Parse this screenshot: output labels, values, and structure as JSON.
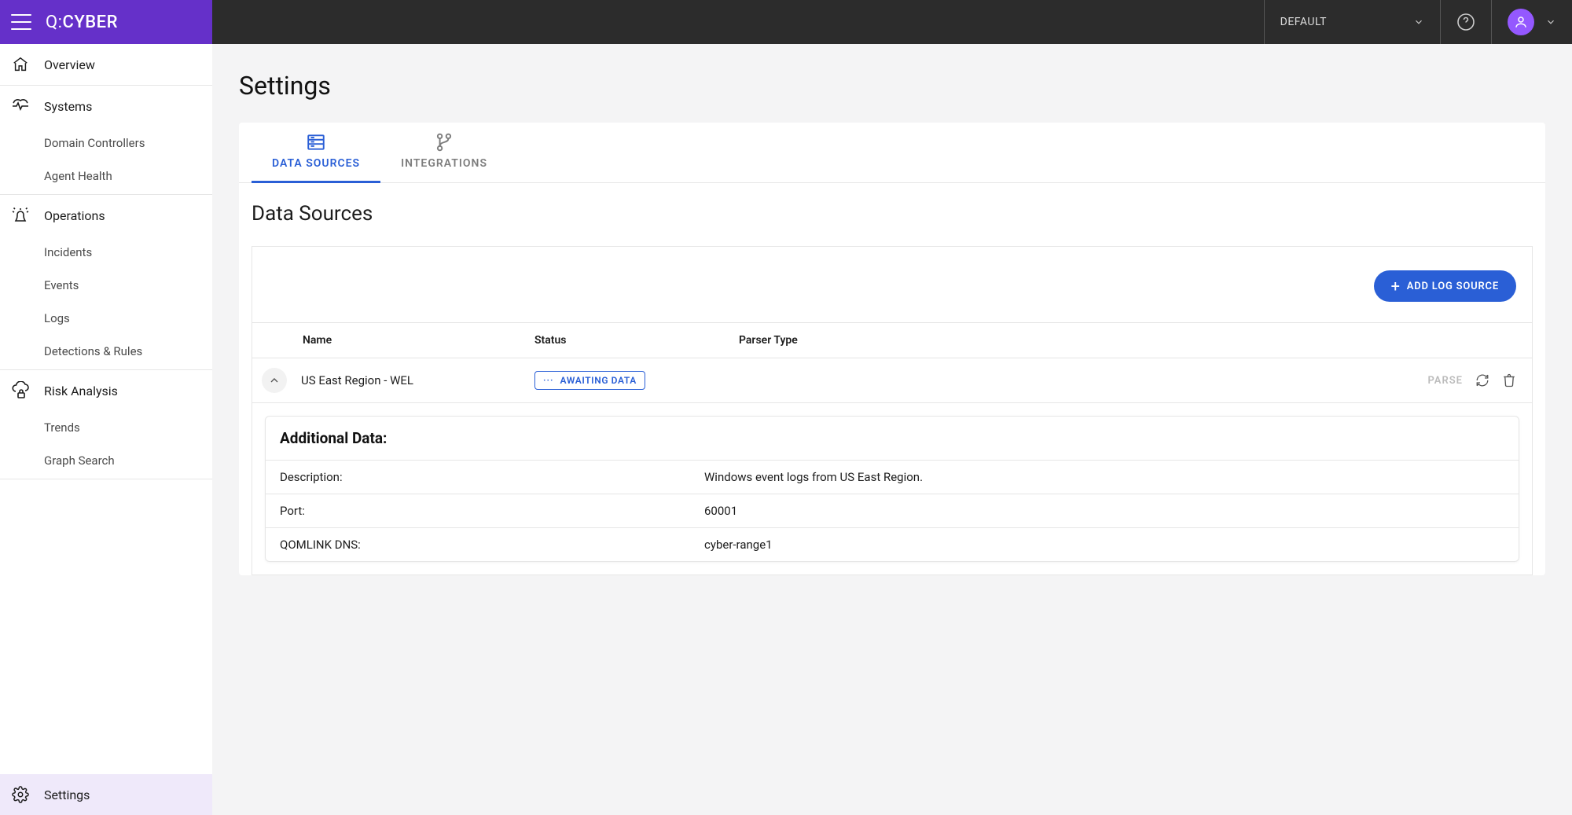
{
  "brand": {
    "prefix": "Q:",
    "name": "CYBER"
  },
  "top": {
    "tenant": "DEFAULT"
  },
  "sidebar": {
    "overview": "Overview",
    "systems": "Systems",
    "systems_children": [
      "Domain Controllers",
      "Agent Health"
    ],
    "operations": "Operations",
    "operations_children": [
      "Incidents",
      "Events",
      "Logs",
      "Detections & Rules"
    ],
    "risk": "Risk Analysis",
    "risk_children": [
      "Trends",
      "Graph Search"
    ],
    "settings": "Settings"
  },
  "page": {
    "title": "Settings"
  },
  "tabs": {
    "data_sources": "DATA SOURCES",
    "integrations": "INTEGRATIONS"
  },
  "section": {
    "title": "Data Sources",
    "add_button": "ADD LOG SOURCE"
  },
  "table": {
    "headers": {
      "name": "Name",
      "status": "Status",
      "parser": "Parser Type"
    }
  },
  "row": {
    "name": "US East Region - WEL",
    "status_label": "AWAITING DATA",
    "parse_button": "PARSE"
  },
  "detail": {
    "title": "Additional Data:",
    "items": [
      {
        "key": "Description:",
        "value": "Windows event logs from US East Region."
      },
      {
        "key": "Port:",
        "value": "60001"
      },
      {
        "key": "QOMLINK DNS:",
        "value": "cyber-range1"
      }
    ]
  }
}
